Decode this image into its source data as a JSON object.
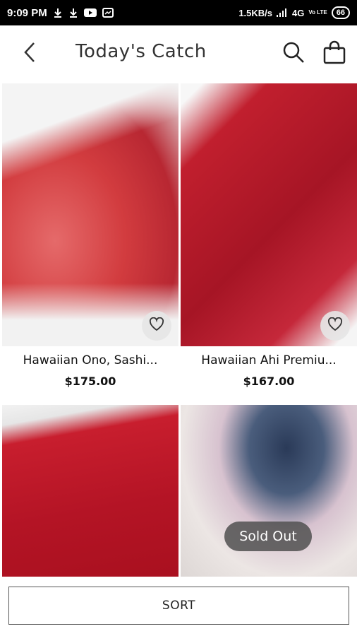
{
  "status_bar": {
    "time": "9:09 PM",
    "network_speed": "1.5KB/s",
    "network_type": "4G",
    "volte": "Vo LTE",
    "battery": "66",
    "icons": [
      "download-icon",
      "download-icon",
      "youtube-icon",
      "photo-icon",
      "signal-icon",
      "battery-icon"
    ]
  },
  "header": {
    "title": "Today's Catch",
    "back_icon": "chevron-left-icon",
    "search_icon": "search-icon",
    "bag_icon": "shopping-bag-icon"
  },
  "products": [
    {
      "name": "Hawaiian Ono, Sashi...",
      "price": "$175.00",
      "favorite_icon": "heart-outline-icon"
    },
    {
      "name": "Hawaiian Ahi Premiu...",
      "price": "$167.00",
      "favorite_icon": "heart-outline-icon"
    },
    {
      "name": "",
      "price": ""
    },
    {
      "name": "",
      "price": "",
      "badge": "Sold Out"
    }
  ],
  "sort_button": {
    "label": "SORT"
  }
}
